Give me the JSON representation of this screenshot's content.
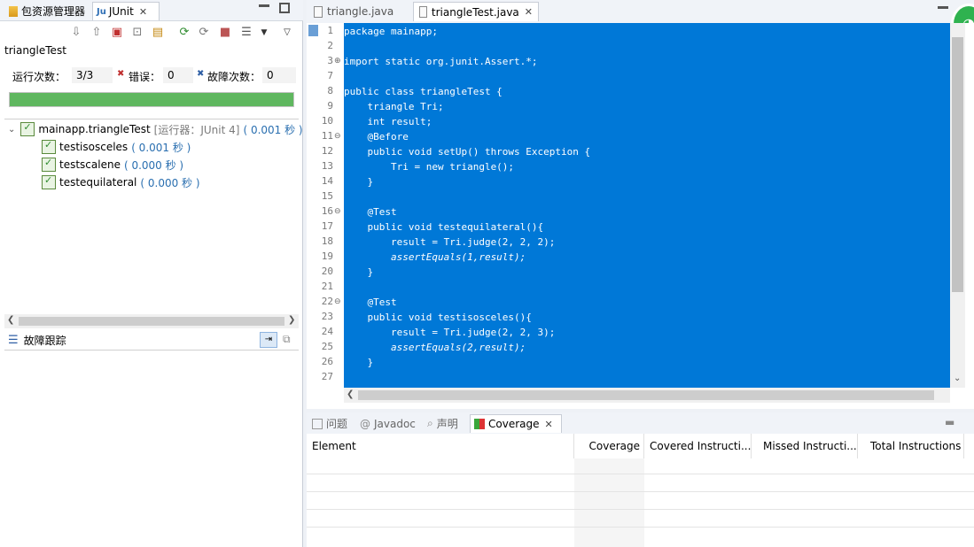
{
  "left_panel": {
    "tabs": [
      {
        "label": "包资源管理器",
        "icon": "package-explorer-icon"
      },
      {
        "label": "JUnit",
        "icon": "junit-icon",
        "active": true
      }
    ],
    "run_title": "triangleTest",
    "counts": {
      "runs_label": "运行次数：",
      "runs_value": "3/3",
      "errors_label": "错误：",
      "errors_value": "0",
      "failures_label": "故障次数：",
      "failures_value": "0"
    },
    "progress_color": "#5fb75f",
    "tree": {
      "root_label": "mainapp.triangleTest",
      "root_runner": "[运行器：JUnit 4]",
      "root_time": "( 0.001 秒 )",
      "items": [
        {
          "label": "testisosceles",
          "time": "( 0.001 秒 )"
        },
        {
          "label": "testscalene",
          "time": "( 0.000 秒 )"
        },
        {
          "label": "testequilateral",
          "time": "( 0.000 秒 )"
        }
      ]
    },
    "failure_trace_label": "故障跟踪"
  },
  "editor": {
    "tabs": [
      {
        "label": "triangle.java"
      },
      {
        "label": "triangleTest.java",
        "active": true
      }
    ],
    "selection_color": "#0078d7",
    "lines": [
      {
        "n": "1",
        "text": "package mainapp;"
      },
      {
        "n": "2",
        "text": ""
      },
      {
        "n": "3",
        "text": "import static org.junit.Assert.*;"
      },
      {
        "n": "7",
        "text": ""
      },
      {
        "n": "8",
        "text": "public class triangleTest {"
      },
      {
        "n": "9",
        "text": "    triangle Tri;"
      },
      {
        "n": "10",
        "text": "    int result;"
      },
      {
        "n": "11",
        "text": "    @Before"
      },
      {
        "n": "12",
        "text": "    public void setUp() throws Exception {"
      },
      {
        "n": "13",
        "text": "        Tri = new triangle();"
      },
      {
        "n": "14",
        "text": "    }"
      },
      {
        "n": "15",
        "text": ""
      },
      {
        "n": "16",
        "text": "    @Test"
      },
      {
        "n": "17",
        "text": "    public void testequilateral(){"
      },
      {
        "n": "18",
        "text": "        result = Tri.judge(2, 2, 2);"
      },
      {
        "n": "19",
        "text": "        assertEquals(1,result);"
      },
      {
        "n": "20",
        "text": "    }"
      },
      {
        "n": "21",
        "text": ""
      },
      {
        "n": "22",
        "text": "    @Test"
      },
      {
        "n": "23",
        "text": "    public void testisosceles(){"
      },
      {
        "n": "24",
        "text": "        result = Tri.judge(2, 2, 3);"
      },
      {
        "n": "25",
        "text": "        assertEquals(2,result);"
      },
      {
        "n": "26",
        "text": "    }"
      },
      {
        "n": "27",
        "text": ""
      }
    ]
  },
  "bottom_panel": {
    "tabs": [
      {
        "label": "问题"
      },
      {
        "label": "Javadoc"
      },
      {
        "label": "声明"
      },
      {
        "label": "Coverage",
        "active": true
      }
    ],
    "columns": [
      "Element",
      "Coverage",
      "Covered Instructi...",
      "Missed Instructi...",
      "Total Instructions"
    ]
  }
}
